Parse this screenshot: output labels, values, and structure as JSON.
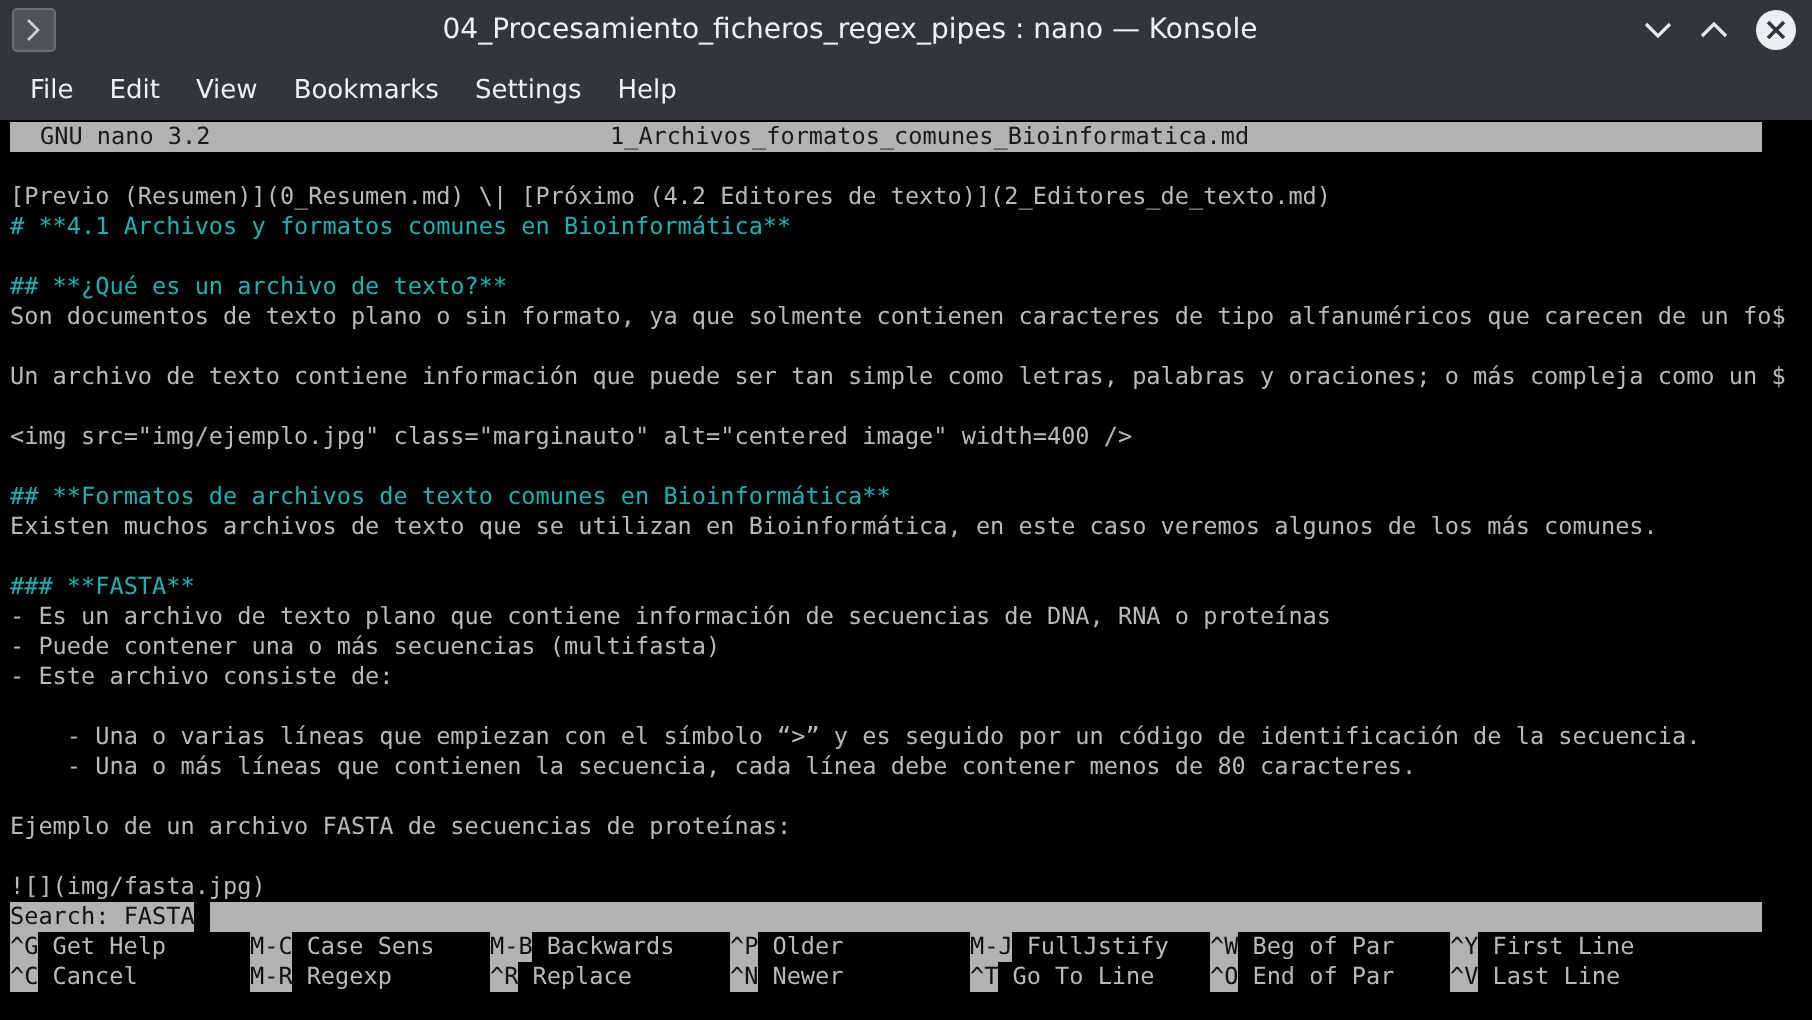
{
  "window": {
    "title": "04_Procesamiento_ficheros_regex_pipes : nano — Konsole"
  },
  "menu": [
    "File",
    "Edit",
    "View",
    "Bookmarks",
    "Settings",
    "Help"
  ],
  "nano": {
    "version": "GNU nano 3.2",
    "filename": "1_Archivos_formatos_comunes_Bioinformatica.md"
  },
  "lines": [
    {
      "kind": "blank"
    },
    {
      "kind": "text",
      "text": "[Previo (Resumen)](0_Resumen.md) \\| [Próximo (4.2 Editores de texto)](2_Editores_de_texto.md)"
    },
    {
      "kind": "heading",
      "text": "# **4.1 Archivos y formatos comunes en Bioinformática**"
    },
    {
      "kind": "blank"
    },
    {
      "kind": "heading",
      "text": "## **¿Qué es un archivo de texto?**"
    },
    {
      "kind": "text",
      "text": "Son documentos de texto plano o sin formato, ya que solmente contienen caracteres de tipo alfanuméricos que carecen de un fo$"
    },
    {
      "kind": "blank"
    },
    {
      "kind": "text",
      "text": "Un archivo de texto contiene información que puede ser tan simple como letras, palabras y oraciones; o más compleja como un $"
    },
    {
      "kind": "blank"
    },
    {
      "kind": "text",
      "text": "<img src=\"img/ejemplo.jpg\" class=\"marginauto\" alt=\"centered image\" width=400 />"
    },
    {
      "kind": "blank"
    },
    {
      "kind": "heading",
      "text": "## **Formatos de archivos de texto comunes en Bioinformática**"
    },
    {
      "kind": "text",
      "text": "Existen muchos archivos de texto que se utilizan en Bioinformática, en este caso veremos algunos de los más comunes."
    },
    {
      "kind": "blank"
    },
    {
      "kind": "heading",
      "text": "### **FASTA**"
    },
    {
      "kind": "text",
      "text": "- Es un archivo de texto plano que contiene información de secuencias de DNA, RNA o proteínas"
    },
    {
      "kind": "text",
      "text": "- Puede contener una o más secuencias (multifasta)"
    },
    {
      "kind": "text",
      "text": "- Este archivo consiste de:"
    },
    {
      "kind": "blank"
    },
    {
      "kind": "text",
      "text": "    - Una o varias líneas que empiezan con el símbolo “>” y es seguido por un código de identificación de la secuencia."
    },
    {
      "kind": "text",
      "text": "    - Una o más líneas que contienen la secuencia, cada línea debe contener menos de 80 caracteres."
    },
    {
      "kind": "blank"
    },
    {
      "kind": "text",
      "text": "Ejemplo de un archivo FASTA de secuencias de proteínas:"
    },
    {
      "kind": "blank"
    },
    {
      "kind": "text",
      "text": "![](img/fasta.jpg)"
    }
  ],
  "search": {
    "label": "Search:",
    "value": "FASTA"
  },
  "shortcuts": [
    [
      {
        "key": "^G",
        "label": "Get Help"
      },
      {
        "key": "M-C",
        "label": "Case Sens"
      },
      {
        "key": "M-B",
        "label": "Backwards"
      },
      {
        "key": "^P",
        "label": "Older"
      },
      {
        "key": "M-J",
        "label": "FullJstify"
      },
      {
        "key": "^W",
        "label": "Beg of Par"
      },
      {
        "key": "^Y",
        "label": "First Line"
      }
    ],
    [
      {
        "key": "^C",
        "label": "Cancel"
      },
      {
        "key": "M-R",
        "label": "Regexp"
      },
      {
        "key": "^R",
        "label": "Replace"
      },
      {
        "key": "^N",
        "label": "Newer"
      },
      {
        "key": "^T",
        "label": "Go To Line"
      },
      {
        "key": "^O",
        "label": "End of Par"
      },
      {
        "key": "^V",
        "label": "Last Line"
      }
    ]
  ]
}
